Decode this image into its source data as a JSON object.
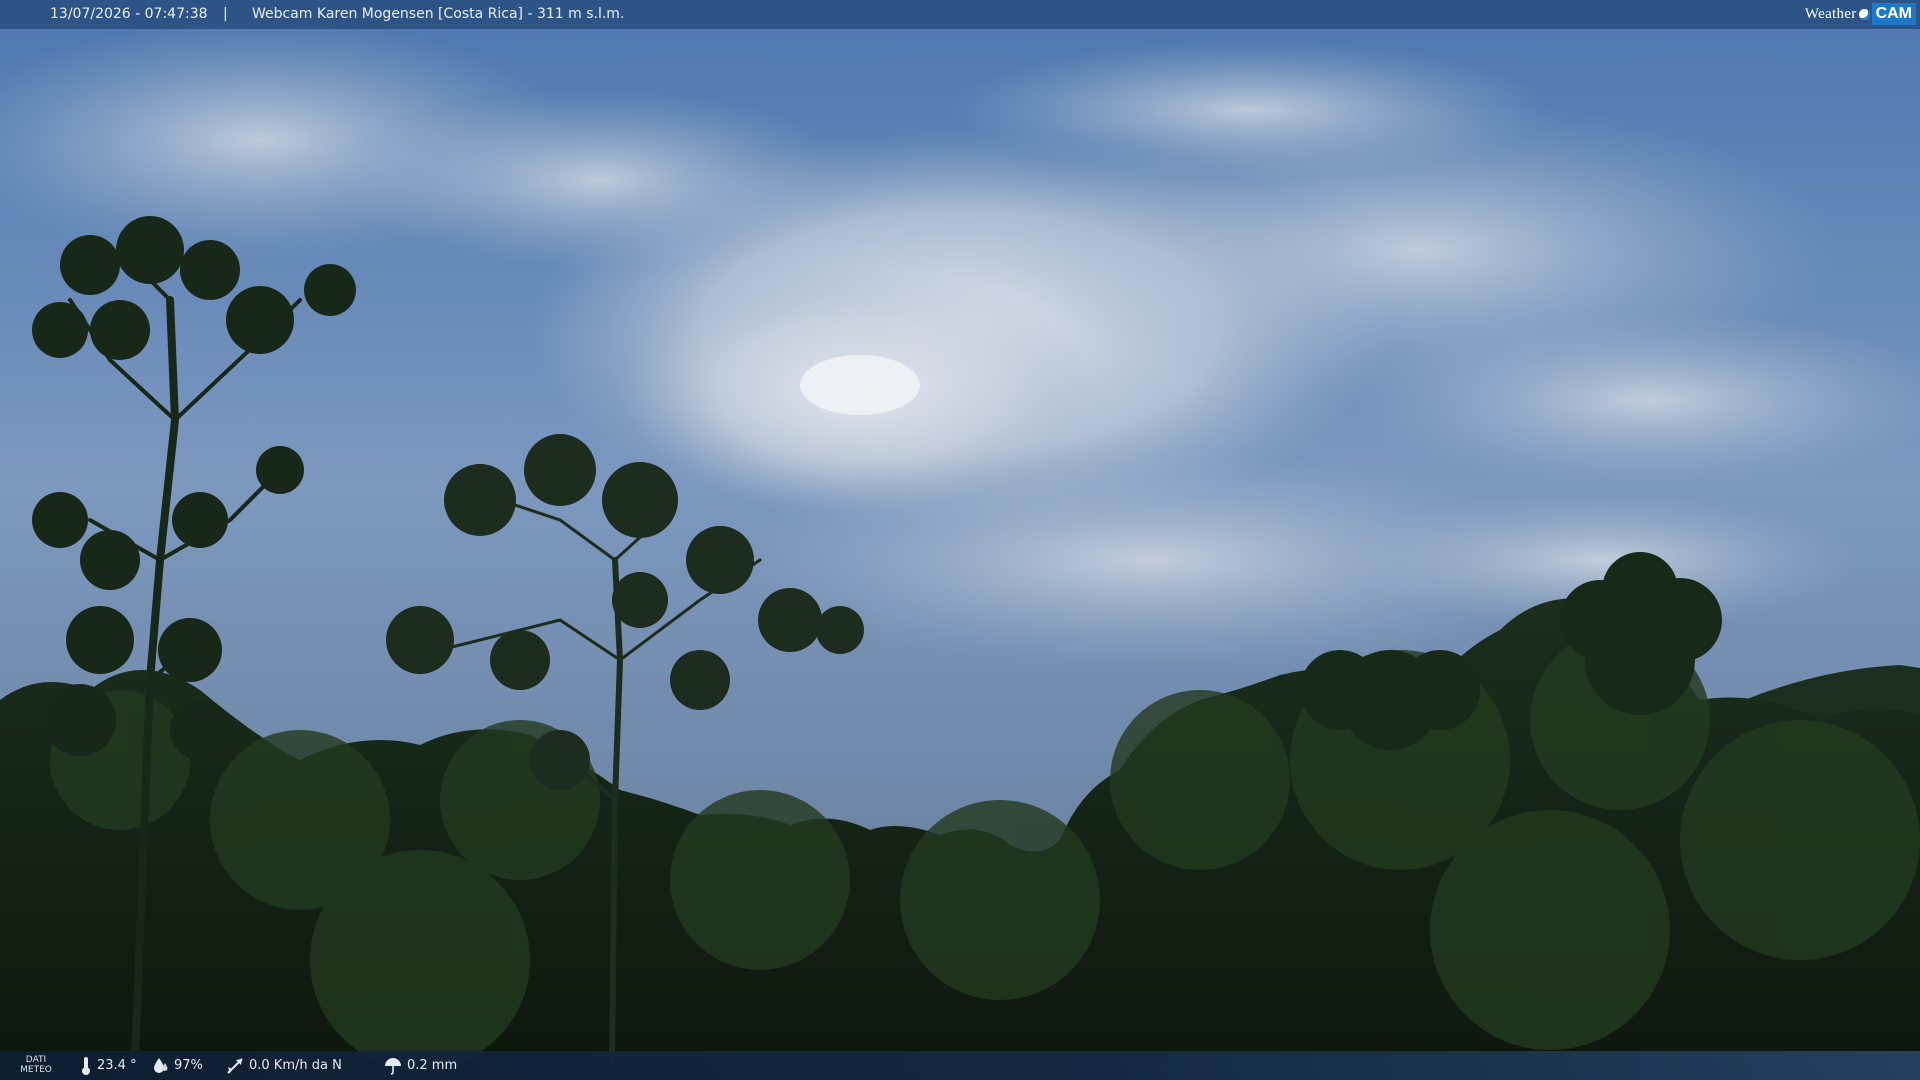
{
  "header": {
    "timestamp": "13/07/2026 - 07:47:38",
    "separator": "|",
    "camera_title": "Webcam Karen Mogensen [Costa Rica] - 311 m s.l.m."
  },
  "logo": {
    "text_weather": "Weather",
    "text_cam": "CAM",
    "brand_color": "#1d78c9"
  },
  "weather_bar": {
    "label": "DATI METEO",
    "temperature": "23.4 °",
    "humidity": "97%",
    "wind": "0.0 Km/h da N",
    "rain": "0.2 mm",
    "icons": {
      "temperature": "thermometer-icon",
      "humidity": "water-drop-icon",
      "wind": "wind-vane-icon",
      "rain": "umbrella-icon"
    }
  },
  "scene": {
    "sky_color": "#5f85b8",
    "cloud_color": "#d6dde6",
    "forest_color": "#10220f"
  }
}
